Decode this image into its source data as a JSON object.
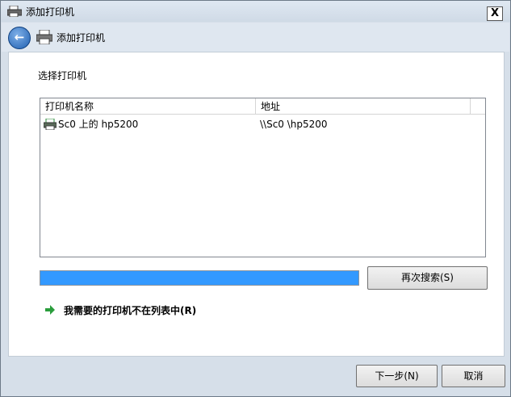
{
  "window": {
    "title": "添加打印机",
    "close_label": "X"
  },
  "nav": {
    "back_label": "←",
    "title": "添加打印机"
  },
  "main": {
    "section_label": "选择打印机",
    "columns": [
      "打印机名称",
      "地址"
    ],
    "rows": [
      {
        "name": "Sc0 上的 hp5200",
        "address": "\\\\Sc0 \\hp5200",
        "icon": "printer-icon"
      }
    ],
    "progress_percent": 100,
    "search_again_label": "再次搜索(S)",
    "not_listed_label": "我需要的打印机不在列表中(R)"
  },
  "footer": {
    "next_label": "下一步(N)",
    "cancel_label": "取消"
  },
  "colors": {
    "accent": "#3399ff",
    "link_arrow": "#2a9d3c"
  }
}
